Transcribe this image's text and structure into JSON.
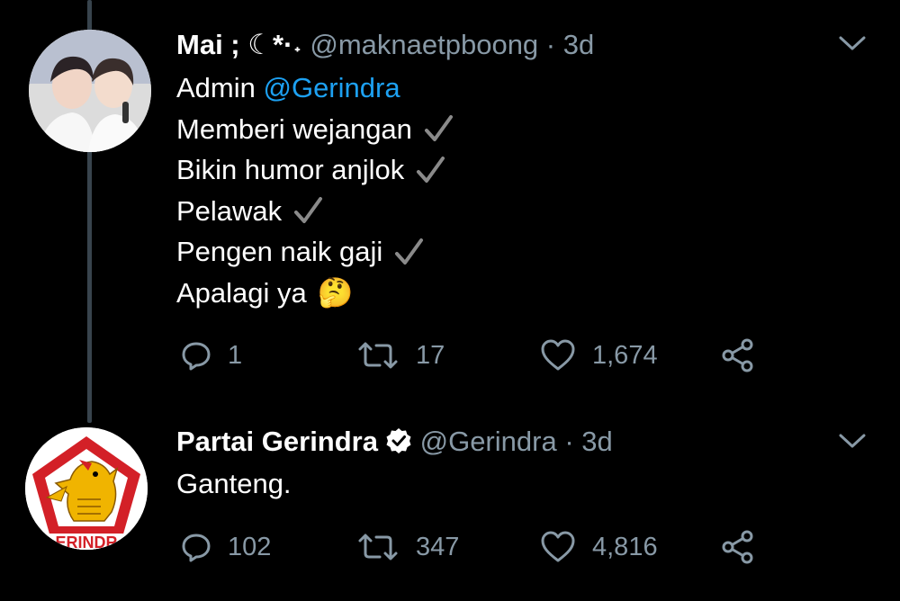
{
  "tweets": [
    {
      "name": "Mai ; ☾*·˖",
      "handle": "@maknaetpboong",
      "time": "· 3d",
      "lines": [
        {
          "text": "Admin ",
          "mention": "@Gerindra",
          "check": false
        },
        {
          "text": "Memberi wejangan",
          "check": true
        },
        {
          "text": "Bikin humor anjlok",
          "check": true
        },
        {
          "text": "Pelawak",
          "check": true
        },
        {
          "text": "Pengen naik gaji",
          "check": true
        },
        {
          "text": "Apalagi ya",
          "emoji": "🤔",
          "check": false
        }
      ],
      "replies": "1",
      "retweets": "17",
      "likes": "1,674"
    },
    {
      "name": "Partai Gerindra",
      "verified": true,
      "handle": "@Gerindra",
      "time": "· 3d",
      "lines": [
        {
          "text": "Ganteng."
        }
      ],
      "replies": "102",
      "retweets": "347",
      "likes": "4,816",
      "avatar_text": "ERINDR"
    }
  ],
  "colors": {
    "background": "#000000",
    "secondary_text": "#8899a6",
    "link": "#1da1f2",
    "gerindra_red": "#d32027",
    "gerindra_gold": "#f0b400"
  }
}
